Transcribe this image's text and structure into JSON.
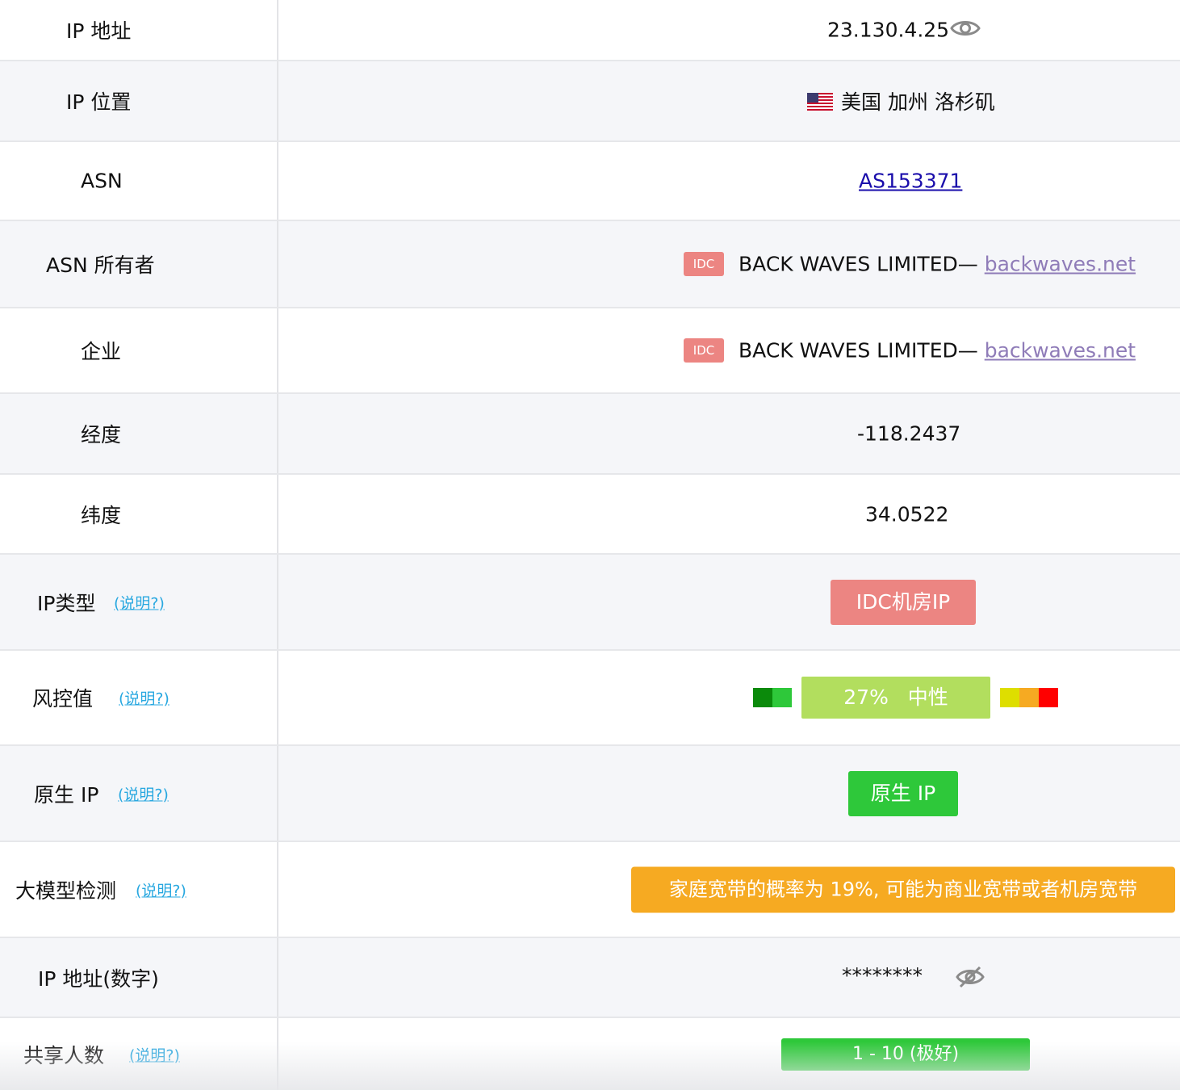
{
  "rows": {
    "ip_address": {
      "label": "IP 地址",
      "value": "23.130.4.25",
      "icon": "eye-icon"
    },
    "ip_location": {
      "label": "IP 位置",
      "flag": "us-flag-icon",
      "value": "美国 加州 洛杉矶"
    },
    "asn": {
      "label": "ASN",
      "value": "AS153371"
    },
    "asn_owner": {
      "label": "ASN 所有者",
      "tag": "IDC",
      "name": "BACK WAVES LIMITED",
      "separator": "—",
      "domain": "backwaves.net"
    },
    "enterprise": {
      "label": "企业",
      "tag": "IDC",
      "name": "BACK WAVES LIMITED",
      "separator": "—",
      "domain": "backwaves.net"
    },
    "longitude": {
      "label": "经度",
      "value": "-118.2437"
    },
    "latitude": {
      "label": "纬度",
      "value": "34.0522"
    },
    "ip_type": {
      "label": "IP类型",
      "help": "(说明?)",
      "value": "IDC机房IP"
    },
    "risk": {
      "label": "风控值",
      "help": "(说明?)",
      "percent": "27%",
      "level": "中性",
      "score": 0.27
    },
    "native_ip": {
      "label": "原生 IP",
      "help": "(说明?)",
      "value": "原生 IP"
    },
    "llm_detect": {
      "label": "大模型检测",
      "help": "(说明?)",
      "value": "家庭宽带的概率为 19%, 可能为商业宽带或者机房宽带"
    },
    "ip_numeric": {
      "label": "IP 地址(数字)",
      "value": "********",
      "icon": "eye-off-icon"
    },
    "shared_users": {
      "label": "共享人数",
      "help": "(说明?)",
      "value": "1 - 10 (极好)"
    }
  },
  "colors": {
    "idc_red": "#ec8582",
    "risk_neutral": "#b2de5e",
    "native_green": "#2ec83a",
    "llm_orange": "#f6aa22",
    "help_blue": "#29a8e0",
    "risk_scale": [
      "#0b8a0b",
      "#2ec83a",
      "#dede00",
      "#f6aa22",
      "#ff0000"
    ]
  }
}
